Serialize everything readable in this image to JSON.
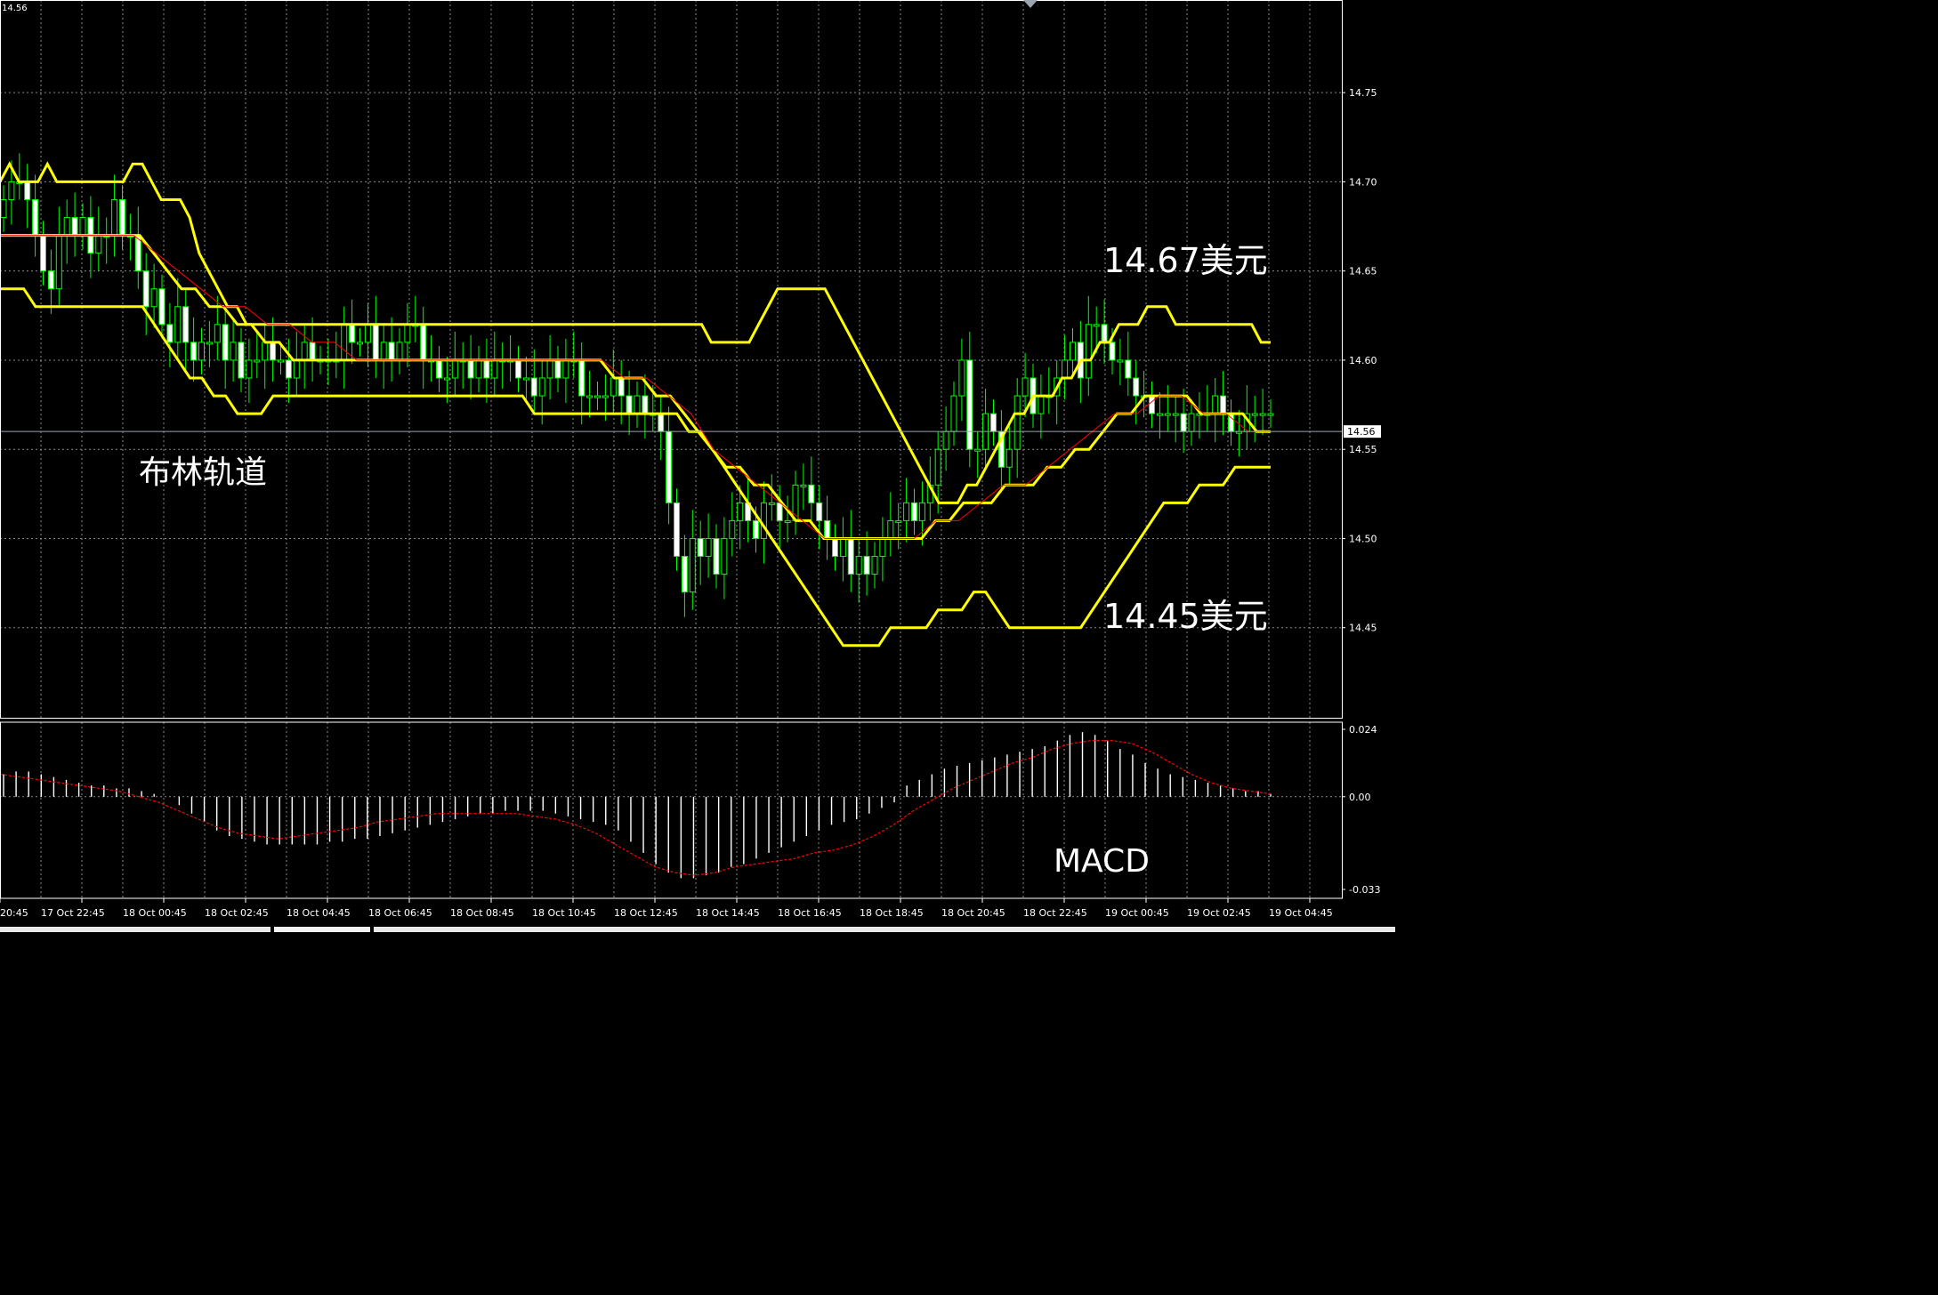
{
  "corner_price": "14.56",
  "annotations": {
    "upper_band_price": "14.67美元",
    "lower_band_price": "14.45美元",
    "bollinger_label": "布林轨道",
    "macd_label": "MACD"
  },
  "colors": {
    "background": "#000000",
    "grid": "#8a8a8a",
    "candle": "#00ff00",
    "band": "#ffff00",
    "middle_ma": "#ff0000",
    "macd_hist": "#ffffff",
    "macd_signal": "#ff0000",
    "current_price_line": "#9aa5b0"
  },
  "chart_data": [
    {
      "type": "candlestick",
      "indicator": "Bollinger Bands",
      "y_range": [
        14.4,
        14.78
      ],
      "y_ticks": [
        "14.75",
        "14.70",
        "14.65",
        "14.60",
        "14.55",
        "14.50",
        "14.45"
      ],
      "current_price": "14.56",
      "x_tick_labels": [
        "20:45",
        "17 Oct 22:45",
        "18 Oct 00:45",
        "18 Oct 02:45",
        "18 Oct 04:45",
        "18 Oct 06:45",
        "18 Oct 08:45",
        "18 Oct 10:45",
        "18 Oct 12:45",
        "18 Oct 14:45",
        "18 Oct 16:45",
        "18 Oct 18:45",
        "18 Oct 20:45",
        "18 Oct 22:45",
        "19 Oct 00:45",
        "19 Oct 02:45",
        "19 Oct 04:45"
      ],
      "close": [
        14.69,
        14.7,
        14.7,
        14.69,
        14.67,
        14.65,
        14.64,
        14.67,
        14.68,
        14.67,
        14.68,
        14.66,
        14.67,
        14.67,
        14.69,
        14.67,
        14.67,
        14.65,
        14.63,
        14.64,
        14.62,
        14.61,
        14.63,
        14.61,
        14.6,
        14.61,
        14.61,
        14.62,
        14.6,
        14.61,
        14.59,
        14.6,
        14.6,
        14.61,
        14.6,
        14.6,
        14.59,
        14.6,
        14.61,
        14.6,
        14.6,
        14.6,
        14.6,
        14.62,
        14.61,
        14.61,
        14.62,
        14.6,
        14.61,
        14.6,
        14.61,
        14.62,
        14.62,
        14.6,
        14.6,
        14.59,
        14.59,
        14.6,
        14.6,
        14.59,
        14.6,
        14.59,
        14.6,
        14.6,
        14.6,
        14.59,
        14.59,
        14.58,
        14.59,
        14.6,
        14.59,
        14.6,
        14.6,
        14.58,
        14.58,
        14.58,
        14.58,
        14.59,
        14.58,
        14.57,
        14.58,
        14.57,
        14.57,
        14.56,
        14.52,
        14.49,
        14.47,
        14.5,
        14.49,
        14.5,
        14.48,
        14.5,
        14.51,
        14.52,
        14.51,
        14.5,
        14.52,
        14.52,
        14.51,
        14.51,
        14.53,
        14.53,
        14.52,
        14.51,
        14.5,
        14.49,
        14.5,
        14.48,
        14.49,
        14.48,
        14.49,
        14.5,
        14.51,
        14.51,
        14.52,
        14.51,
        14.52,
        14.53,
        14.55,
        14.56,
        14.58,
        14.6,
        14.55,
        14.55,
        14.57,
        14.56,
        14.54,
        14.55,
        14.58,
        14.59,
        14.57,
        14.58,
        14.58,
        14.59,
        14.6,
        14.61,
        14.59,
        14.62,
        14.62,
        14.61,
        14.6,
        14.6,
        14.59,
        14.58,
        14.58,
        14.57,
        14.57,
        14.57,
        14.57,
        14.56,
        14.57,
        14.57,
        14.57,
        14.58,
        14.57,
        14.56,
        14.56,
        14.57,
        14.57,
        14.57,
        14.57
      ],
      "upper_band": [
        14.7,
        14.71,
        14.7,
        14.7,
        14.7,
        14.71,
        14.7,
        14.7,
        14.7,
        14.7,
        14.7,
        14.7,
        14.7,
        14.7,
        14.71,
        14.71,
        14.7,
        14.69,
        14.69,
        14.69,
        14.68,
        14.66,
        14.65,
        14.64,
        14.63,
        14.63,
        14.62,
        14.62,
        14.62,
        14.62,
        14.62,
        14.62,
        14.62,
        14.62,
        14.62,
        14.62,
        14.62,
        14.62,
        14.62,
        14.62,
        14.62,
        14.62,
        14.62,
        14.62,
        14.62,
        14.62,
        14.62,
        14.62,
        14.62,
        14.62,
        14.62,
        14.62,
        14.62,
        14.62,
        14.62,
        14.62,
        14.62,
        14.62,
        14.62,
        14.62,
        14.62,
        14.62,
        14.62,
        14.62,
        14.62,
        14.62,
        14.62,
        14.62,
        14.62,
        14.62,
        14.62,
        14.62,
        14.62,
        14.62,
        14.62,
        14.61,
        14.61,
        14.61,
        14.61,
        14.61,
        14.62,
        14.63,
        14.64,
        14.64,
        14.64,
        14.64,
        14.64,
        14.64,
        14.63,
        14.62,
        14.61,
        14.6,
        14.59,
        14.58,
        14.57,
        14.56,
        14.55,
        14.54,
        14.53,
        14.52,
        14.52,
        14.52,
        14.53,
        14.53,
        14.54,
        14.55,
        14.56,
        14.57,
        14.57,
        14.58,
        14.58,
        14.58,
        14.59,
        14.59,
        14.6,
        14.6,
        14.61,
        14.61,
        14.62,
        14.62,
        14.62,
        14.63,
        14.63,
        14.63,
        14.62,
        14.62,
        14.62,
        14.62,
        14.62,
        14.62,
        14.62,
        14.62,
        14.62,
        14.61,
        14.61
      ],
      "middle_band": [
        14.67,
        14.67,
        14.67,
        14.67,
        14.67,
        14.67,
        14.67,
        14.67,
        14.67,
        14.67,
        14.67,
        14.66,
        14.65,
        14.64,
        14.64,
        14.63,
        14.63,
        14.62,
        14.62,
        14.61,
        14.61,
        14.6,
        14.6,
        14.6,
        14.6,
        14.6,
        14.6,
        14.6,
        14.6,
        14.6,
        14.6,
        14.6,
        14.6,
        14.6,
        14.6,
        14.6,
        14.6,
        14.6,
        14.6,
        14.6,
        14.6,
        14.6,
        14.6,
        14.6,
        14.59,
        14.59,
        14.59,
        14.58,
        14.58,
        14.57,
        14.56,
        14.55,
        14.54,
        14.54,
        14.53,
        14.53,
        14.52,
        14.51,
        14.51,
        14.5,
        14.5,
        14.5,
        14.5,
        14.5,
        14.5,
        14.5,
        14.5,
        14.51,
        14.51,
        14.52,
        14.52,
        14.52,
        14.53,
        14.53,
        14.53,
        14.54,
        14.54,
        14.55,
        14.55,
        14.56,
        14.57,
        14.57,
        14.58,
        14.58,
        14.58,
        14.58,
        14.57,
        14.57,
        14.57,
        14.57,
        14.56,
        14.56
      ],
      "middle_ma": [
        14.67,
        14.67,
        14.67,
        14.67,
        14.67,
        14.67,
        14.67,
        14.66,
        14.65,
        14.64,
        14.63,
        14.63,
        14.62,
        14.62,
        14.61,
        14.61,
        14.6,
        14.6,
        14.6,
        14.6,
        14.6,
        14.6,
        14.6,
        14.6,
        14.6,
        14.6,
        14.6,
        14.6,
        14.59,
        14.59,
        14.58,
        14.57,
        14.55,
        14.54,
        14.53,
        14.52,
        14.51,
        14.5,
        14.5,
        14.5,
        14.5,
        14.5,
        14.51,
        14.51,
        14.52,
        14.53,
        14.53,
        14.54,
        14.55,
        14.56,
        14.57,
        14.57,
        14.58,
        14.58,
        14.57,
        14.57,
        14.56,
        14.56
      ],
      "lower_band": [
        14.64,
        14.64,
        14.64,
        14.63,
        14.63,
        14.63,
        14.63,
        14.63,
        14.63,
        14.63,
        14.63,
        14.63,
        14.63,
        14.62,
        14.61,
        14.6,
        14.59,
        14.59,
        14.58,
        14.58,
        14.57,
        14.57,
        14.57,
        14.58,
        14.58,
        14.58,
        14.58,
        14.58,
        14.58,
        14.58,
        14.58,
        14.58,
        14.58,
        14.58,
        14.58,
        14.58,
        14.58,
        14.58,
        14.58,
        14.58,
        14.58,
        14.58,
        14.58,
        14.58,
        14.58,
        14.57,
        14.57,
        14.57,
        14.57,
        14.57,
        14.57,
        14.57,
        14.57,
        14.57,
        14.57,
        14.57,
        14.57,
        14.57,
        14.56,
        14.56,
        14.55,
        14.54,
        14.53,
        14.52,
        14.51,
        14.5,
        14.49,
        14.48,
        14.47,
        14.46,
        14.45,
        14.44,
        14.44,
        14.44,
        14.44,
        14.45,
        14.45,
        14.45,
        14.45,
        14.46,
        14.46,
        14.46,
        14.47,
        14.47,
        14.46,
        14.45,
        14.45,
        14.45,
        14.45,
        14.45,
        14.45,
        14.45,
        14.46,
        14.47,
        14.48,
        14.49,
        14.5,
        14.51,
        14.52,
        14.52,
        14.52,
        14.53,
        14.53,
        14.53,
        14.54,
        14.54,
        14.54,
        14.54
      ]
    },
    {
      "type": "bar",
      "indicator": "MACD",
      "y_range": [
        -0.033,
        0.024
      ],
      "y_ticks": [
        "0.024",
        "0.00",
        "-0.033"
      ],
      "histogram": [
        0.008,
        0.009,
        0.009,
        0.008,
        0.007,
        0.006,
        0.005,
        0.004,
        0.004,
        0.003,
        0.003,
        0.002,
        0.001,
        0.0,
        -0.003,
        -0.006,
        -0.009,
        -0.012,
        -0.014,
        -0.015,
        -0.016,
        -0.017,
        -0.017,
        -0.017,
        -0.017,
        -0.017,
        -0.016,
        -0.016,
        -0.015,
        -0.015,
        -0.014,
        -0.013,
        -0.012,
        -0.011,
        -0.01,
        -0.009,
        -0.008,
        -0.007,
        -0.006,
        -0.006,
        -0.005,
        -0.005,
        -0.005,
        -0.005,
        -0.006,
        -0.007,
        -0.008,
        -0.009,
        -0.01,
        -0.012,
        -0.016,
        -0.02,
        -0.024,
        -0.027,
        -0.029,
        -0.029,
        -0.028,
        -0.027,
        -0.025,
        -0.024,
        -0.022,
        -0.02,
        -0.018,
        -0.016,
        -0.014,
        -0.012,
        -0.01,
        -0.009,
        -0.008,
        -0.006,
        -0.004,
        -0.002,
        0.004,
        0.006,
        0.008,
        0.01,
        0.011,
        0.012,
        0.013,
        0.014,
        0.015,
        0.016,
        0.017,
        0.018,
        0.02,
        0.022,
        0.023,
        0.022,
        0.02,
        0.017,
        0.015,
        0.012,
        0.01,
        0.008,
        0.007,
        0.006,
        0.005,
        0.004,
        0.003,
        0.002,
        0.002,
        0.001
      ],
      "signal": [
        0.008,
        0.007,
        0.006,
        0.005,
        0.004,
        0.003,
        0.002,
        0.0,
        -0.002,
        -0.005,
        -0.008,
        -0.011,
        -0.013,
        -0.014,
        -0.015,
        -0.014,
        -0.013,
        -0.012,
        -0.011,
        -0.009,
        -0.008,
        -0.007,
        -0.006,
        -0.006,
        -0.006,
        -0.006,
        -0.006,
        -0.007,
        -0.008,
        -0.01,
        -0.013,
        -0.017,
        -0.021,
        -0.025,
        -0.027,
        -0.028,
        -0.027,
        -0.025,
        -0.024,
        -0.023,
        -0.022,
        -0.02,
        -0.019,
        -0.017,
        -0.014,
        -0.01,
        -0.005,
        -0.001,
        0.003,
        0.006,
        0.009,
        0.012,
        0.014,
        0.017,
        0.019,
        0.02,
        0.02,
        0.019,
        0.016,
        0.012,
        0.008,
        0.005,
        0.003,
        0.002,
        0.001
      ]
    }
  ]
}
